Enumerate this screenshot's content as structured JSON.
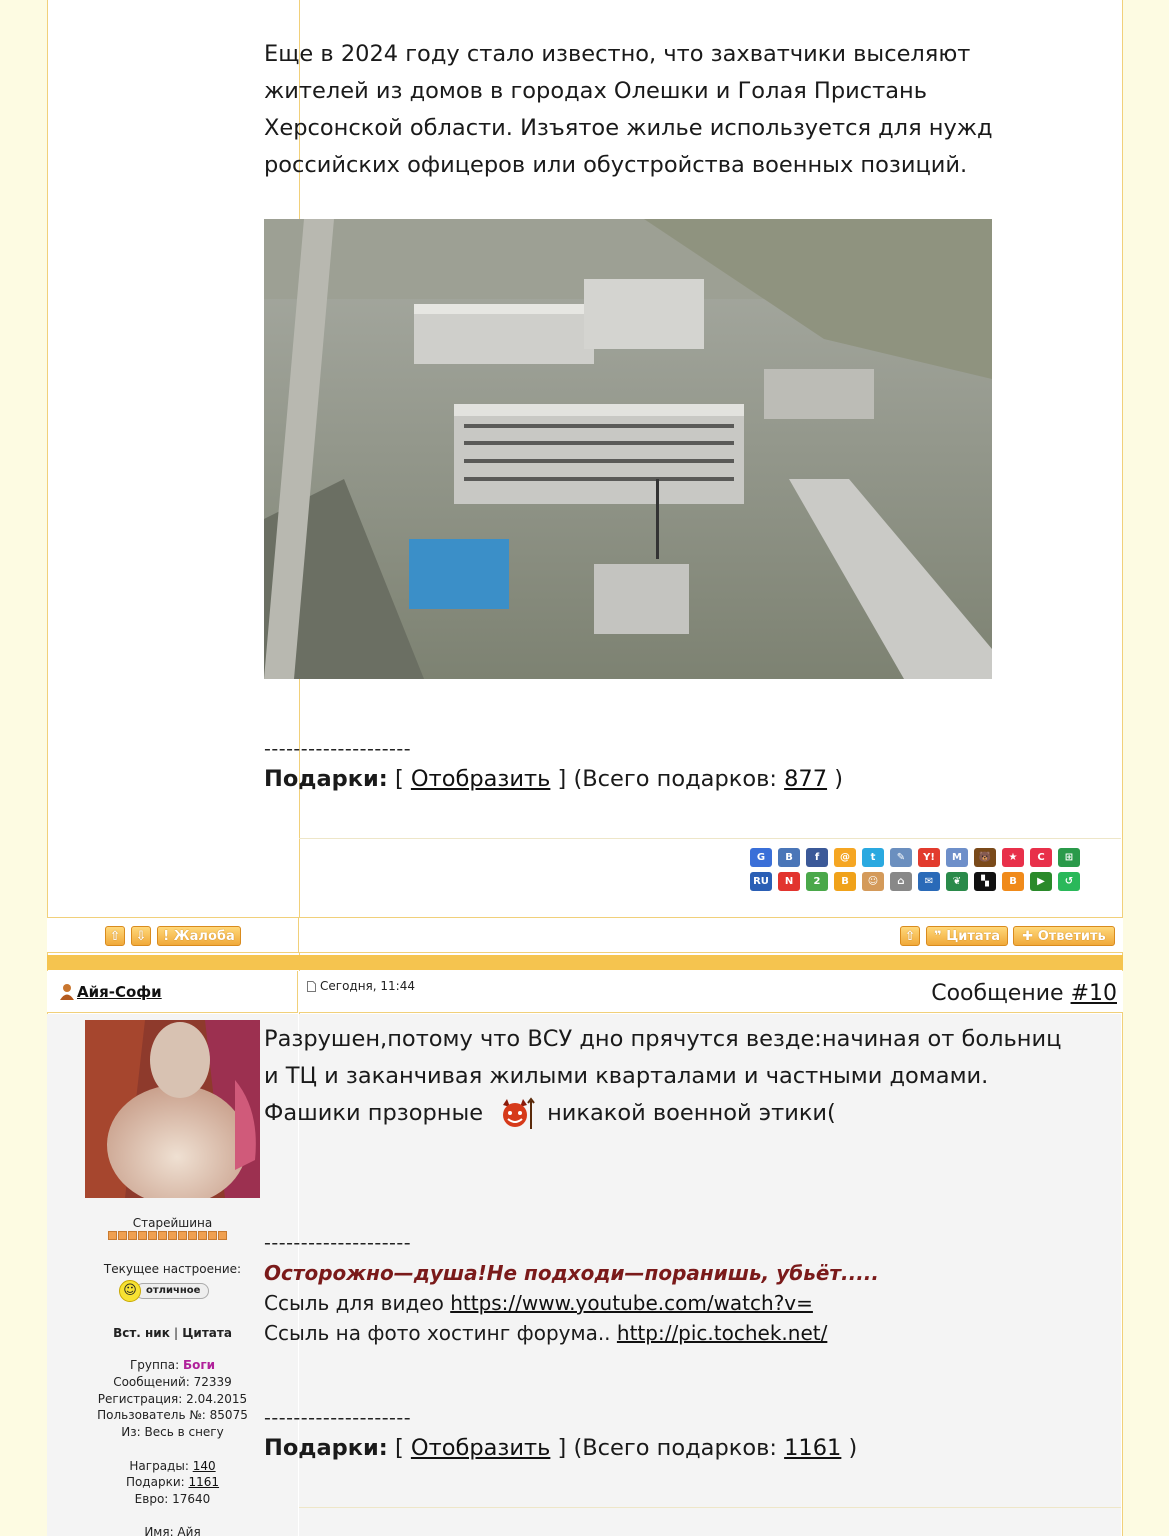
{
  "post1": {
    "text": "Еще в 2024 году стало известно, что захватчики выселяют жителей из домов в городах Олешки и Голая Пристань Херсонской области. Изъятое жилье используется для нужд российских офицеров или обустройства военных позиций.",
    "separator": "--------------------",
    "gifts_label": "Подарки:",
    "gifts_open": "[",
    "gifts_show": "Отобразить",
    "gifts_total_prefix": "] (Всего подарков:",
    "gifts_count": "877",
    "gifts_close": ")"
  },
  "share_icons": {
    "row1": [
      "G",
      "B",
      "f",
      "@",
      "t",
      "✎",
      "Y!",
      "M",
      "🐻",
      "★",
      "C",
      "⊞"
    ],
    "row2": [
      "RU",
      "N",
      "2",
      "B",
      "☺",
      "⌂",
      "✉",
      "❦",
      "▚",
      "B",
      "▶",
      "↺"
    ]
  },
  "buttons": {
    "complaint": "Жалоба",
    "quote": "Цитата",
    "reply": "Ответить"
  },
  "post2": {
    "author": "Айя-Софи",
    "date": "Сегодня, 11:44",
    "msg_label": "Сообщение",
    "msg_number": "#10",
    "line1": "Разрушен,потому что ВСУ дно прячутся везде:начиная от больниц и ТЦ и заканчивая жилыми кварталами и частными домами.",
    "line2a": "Фашики прзорные",
    "line2b": "никакой военной этики(",
    "separator": "--------------------",
    "signature_quote": "Осторожно—душа!Не подходи—поранишь, убьёт.....",
    "video_label": "Ссыль для видео",
    "video_url": "https://www.youtube.com/watch?v=",
    "photo_label": "Ссыль на фото хостинг форума..",
    "photo_url": "http://pic.tochek.net/",
    "separator2": "--------------------",
    "gifts_label": "Подарки:",
    "gifts_open": "[",
    "gifts_show": "Отобразить",
    "gifts_total_prefix": "] (Всего подарков:",
    "gifts_count": "1161",
    "gifts_close": ")"
  },
  "profile": {
    "rank": "Старейшина",
    "mood_label": "Текущее настроение:",
    "mood_value": "отличное",
    "insert_nick": "Вст. ник",
    "pipe": "|",
    "quote_link": "Цитата",
    "group_label": "Группа:",
    "group_value": "Боги",
    "messages": "Сообщений: 72339",
    "registration": "Регистрация: 2.04.2015",
    "user_no": "Пользователь №: 85075",
    "from": "Из: Весь в снегу",
    "awards_label": "Награды:",
    "awards_value": "140",
    "gifts_label": "Подарки:",
    "gifts_value": "1161",
    "euro": "Евро: 17640",
    "name": "Имя: Айя"
  }
}
